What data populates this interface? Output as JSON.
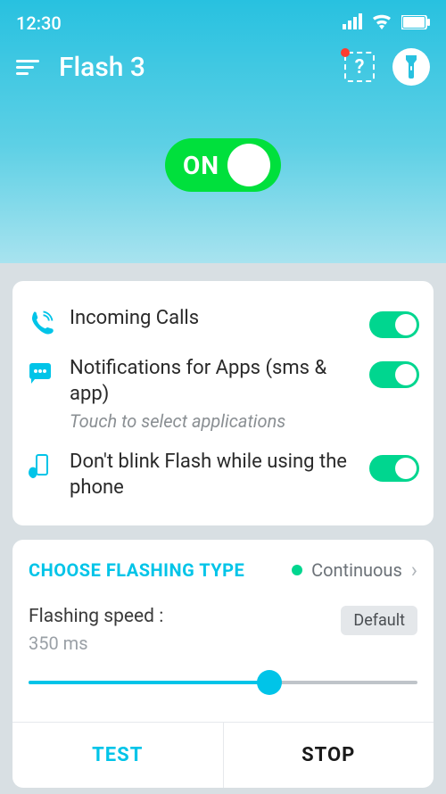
{
  "status": {
    "time": "12:30"
  },
  "app": {
    "title": "Flash 3"
  },
  "mainToggle": {
    "label": "ON",
    "on": true
  },
  "settings": [
    {
      "title": "Incoming Calls",
      "subtitle": "",
      "on": true
    },
    {
      "title": "Notifications for Apps (sms & app)",
      "subtitle": "Touch to select applications",
      "on": true
    },
    {
      "title": "Don't blink Flash while using the phone",
      "subtitle": "",
      "on": true
    }
  ],
  "flashingType": {
    "header": "CHOOSE FLASHING TYPE",
    "value": "Continuous"
  },
  "speed": {
    "label": "Flashing speed :",
    "value": "350 ms",
    "defaultLabel": "Default"
  },
  "actions": {
    "test": "TEST",
    "stop": "STOP"
  }
}
